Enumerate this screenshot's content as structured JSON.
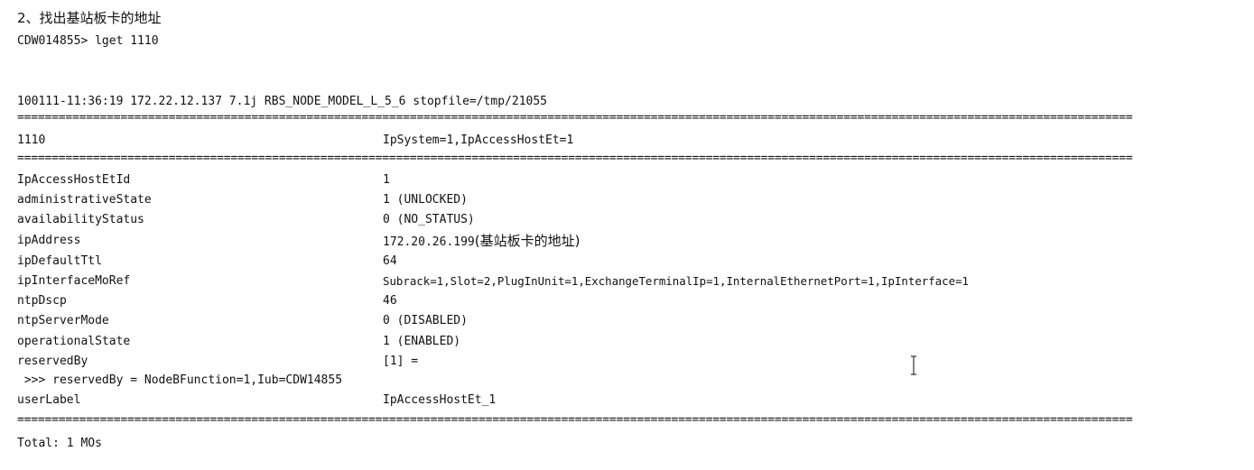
{
  "heading": "2、找出基站板卡的地址",
  "prompt": "CDW014855> lget 1110",
  "info_line": "100111-11:36:19 172.22.12.137 7.1j RBS_NODE_MODEL_L_5_6 stopfile=/tmp/21055",
  "separator": "==================================================================================================================================================================",
  "mo_header": {
    "id": "1110",
    "ldn": "IpSystem=1,IpAccessHostEt=1"
  },
  "attributes": [
    {
      "name": "IpAccessHostEtId",
      "value": "1"
    },
    {
      "name": "administrativeState",
      "value": "1 (UNLOCKED)"
    },
    {
      "name": "availabilityStatus",
      "value": "0 (NO_STATUS)"
    },
    {
      "name": "ipAddress",
      "value": "172.20.26.199",
      "note": "(基站板卡的地址)"
    },
    {
      "name": "ipDefaultTtl",
      "value": "64"
    },
    {
      "name": "ipInterfaceMoRef",
      "value": "Subrack=1,Slot=2,PlugInUnit=1,ExchangeTerminalIp=1,InternalEthernetPort=1,IpInterface=1"
    },
    {
      "name": "ntpDscp",
      "value": "46"
    },
    {
      "name": "ntpServerMode",
      "value": "0 (DISABLED)"
    },
    {
      "name": "operationalState",
      "value": "1 (ENABLED)"
    },
    {
      "name": "reservedBy",
      "value": "[1] ="
    }
  ],
  "reserved_by_detail": " >>> reservedBy = NodeBFunction=1,Iub=CDW14855",
  "user_label": {
    "name": "userLabel",
    "value": "IpAccessHostEt_1"
  },
  "total": "Total: 1 MOs"
}
